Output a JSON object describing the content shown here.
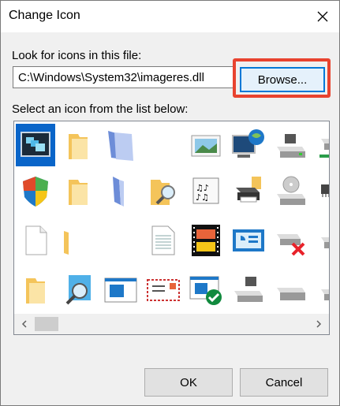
{
  "window": {
    "title": "Change Icon"
  },
  "file_section": {
    "label": "Look for icons in this file:",
    "path_value": "C:\\Windows\\System32\\imageres.dll",
    "browse_label": "Browse..."
  },
  "list_section": {
    "label": "Select an icon from the list below:"
  },
  "icons": [
    [
      "desktop-windows-icon",
      "folder-icon",
      "blank-document-icon",
      "",
      "picture-icon",
      "computer-globe-icon",
      "drive-icon",
      "network-drive-icon"
    ],
    [
      "shield-icon",
      "folder-icon",
      "blank-document-icon",
      "folder-search-icon",
      "music-document-icon",
      "printer-icon",
      "optical-drive-icon",
      "chip-icon"
    ],
    [
      "blank-document-icon",
      "folder-icon",
      "",
      "text-document-icon",
      "video-document-icon",
      "control-panel-icon",
      "disconnected-drive-icon",
      "drive-icon"
    ],
    [
      "folder-icon",
      "search-icon",
      "window-icon",
      "mail-icon",
      "window-checkmark-icon",
      "drive-icon",
      "drive-icon",
      "windows-drive-icon"
    ]
  ],
  "selected_icon": "desktop-windows-icon",
  "footer": {
    "ok_label": "OK",
    "cancel_label": "Cancel"
  },
  "colors": {
    "accent": "#0078d7",
    "highlight": "#e8432f",
    "selection": "#0a65c9"
  }
}
